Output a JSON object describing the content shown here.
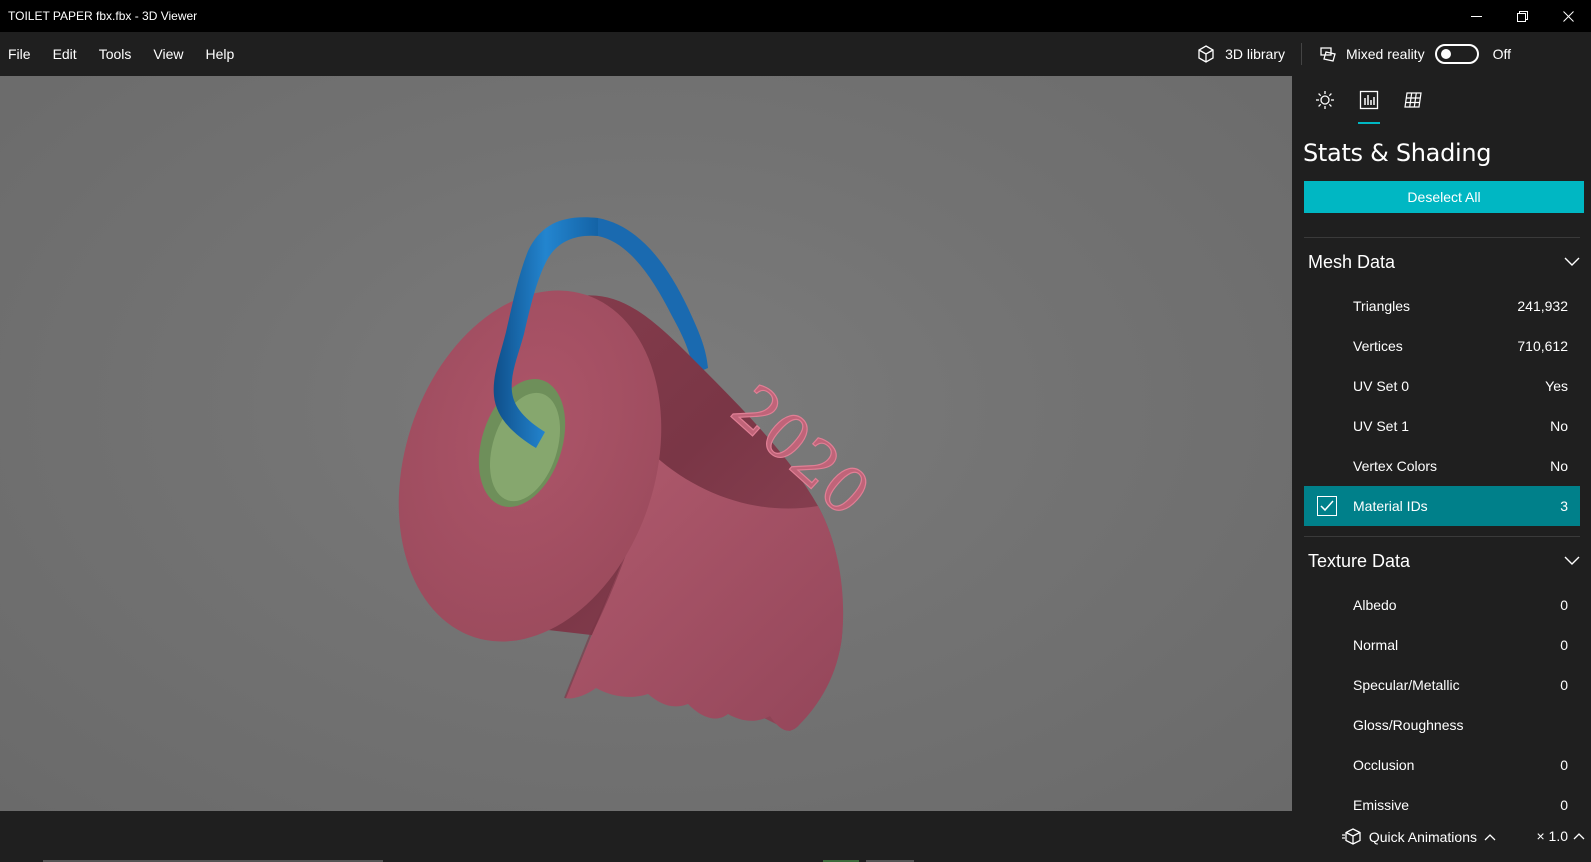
{
  "window": {
    "title": "TOILET PAPER fbx.fbx - 3D Viewer"
  },
  "menu": {
    "items": [
      "File",
      "Edit",
      "Tools",
      "View",
      "Help"
    ]
  },
  "toolbar": {
    "library_label": "3D library",
    "mixed_reality_label": "Mixed reality",
    "mixed_reality_state": "Off"
  },
  "model": {
    "embossed_text": "2020",
    "colors": {
      "paper": "#a04c5e",
      "core": "#7f9e68",
      "handle": "#1f72b8"
    }
  },
  "panel": {
    "title": "Stats & Shading",
    "deselect_label": "Deselect All",
    "mesh": {
      "title": "Mesh Data",
      "rows": [
        {
          "label": "Triangles",
          "value": "241,932"
        },
        {
          "label": "Vertices",
          "value": "710,612"
        },
        {
          "label": "UV Set 0",
          "value": "Yes"
        },
        {
          "label": "UV Set 1",
          "value": "No"
        },
        {
          "label": "Vertex Colors",
          "value": "No"
        },
        {
          "label": "Material IDs",
          "value": "3",
          "checked": true
        }
      ]
    },
    "texture": {
      "title": "Texture Data",
      "rows": [
        {
          "label": "Albedo",
          "value": "0"
        },
        {
          "label": "Normal",
          "value": "0"
        },
        {
          "label": "Specular/Metallic",
          "value": "0"
        },
        {
          "label": "Gloss/Roughness",
          "value": ""
        },
        {
          "label": "Occlusion",
          "value": "0"
        },
        {
          "label": "Emissive",
          "value": "0"
        }
      ]
    }
  },
  "bottom": {
    "quick_animations_label": "Quick Animations",
    "speed_label": "× 1.0"
  },
  "colors": {
    "accent": "#00b7c3",
    "selected_row": "#00808a"
  }
}
